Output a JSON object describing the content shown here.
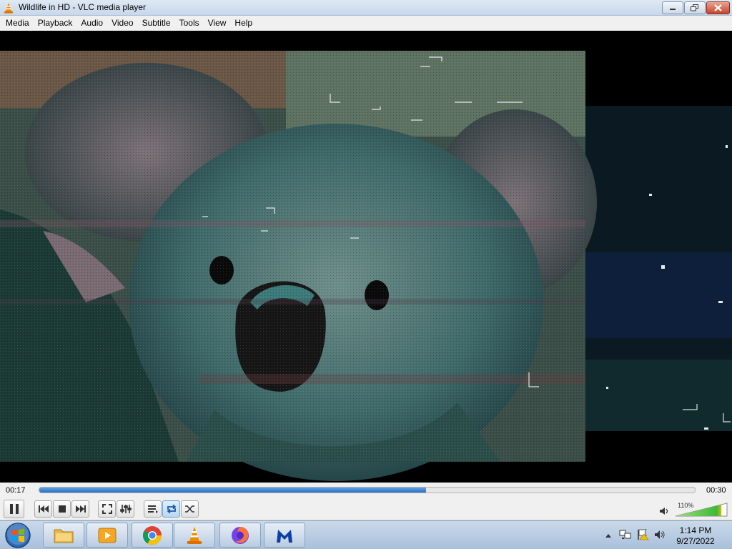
{
  "window": {
    "title": "Wildlife in HD - VLC media player"
  },
  "menu": {
    "items": [
      "Media",
      "Playback",
      "Audio",
      "Video",
      "Subtitle",
      "Tools",
      "View",
      "Help"
    ]
  },
  "player": {
    "current_time": "00:17",
    "total_time": "00:30",
    "progress_fraction": 0.59,
    "volume_label": "110%",
    "volume_fraction": 1.1
  },
  "taskbar": {
    "apps": [
      "explorer",
      "media-player",
      "chrome",
      "vlc",
      "firefox",
      "malwarebytes"
    ],
    "clock_time": "1:14 PM",
    "clock_date": "9/27/2022"
  },
  "colors": {
    "accent": "#2a6ec6",
    "vlc_orange": "#f28a00",
    "volume_green": "#3db83a"
  }
}
